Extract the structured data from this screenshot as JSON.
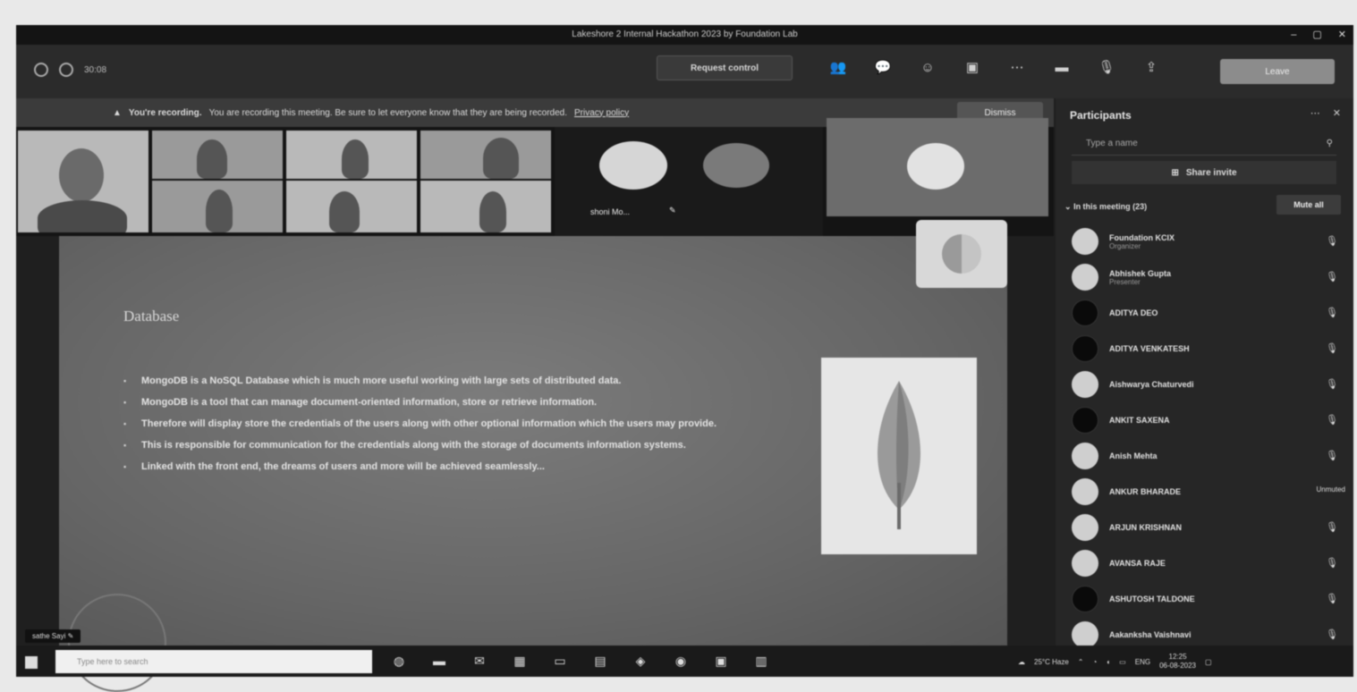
{
  "window": {
    "title": "Lakeshore 2 Internal Hackathon 2023 by Foundation Lab",
    "controls": [
      "–",
      "▢",
      "✕"
    ]
  },
  "toolbar": {
    "meeting_timer": "30:08",
    "request_control": "Request control",
    "icons": [
      "people-icon",
      "chat-icon",
      "reactions-icon",
      "rooms-icon",
      "more-icon",
      "camera-icon",
      "mic-icon",
      "share-icon"
    ],
    "leave_label": "Leave"
  },
  "banner": {
    "strong": "You're recording.",
    "text": "You are recording this meeting. Be sure to let everyone know that they are being recorded.",
    "link": "Privacy policy",
    "dismiss": "Dismiss"
  },
  "video_tiles": {
    "named_tile": "shoni Mo..."
  },
  "slide": {
    "title": "Database",
    "bullets": [
      "MongoDB is a NoSQL Database which is much more useful working with large sets of distributed data.",
      "MongoDB is a tool that can manage document-oriented information, store or retrieve information.",
      "Therefore will display store the credentials of the users along with other optional information which the users may provide.",
      "This is responsible for communication for the credentials along with the storage of documents information systems.",
      "Linked with the front end, the dreams of users and more will be achieved seamlessly..."
    ]
  },
  "presenter_label": "sathe Sayi",
  "participants": {
    "header": "Participants",
    "search_placeholder": "Type a name",
    "share_invite": "Share invite",
    "in_meeting": "In this meeting (23)",
    "mute_all": "Mute all",
    "list": [
      {
        "name": "Foundation KCIX",
        "role": "Organizer",
        "dark": false,
        "status": ""
      },
      {
        "name": "Abhishek Gupta",
        "role": "Presenter",
        "dark": false,
        "status": ""
      },
      {
        "name": "ADITYA DEO",
        "role": "",
        "dark": true,
        "status": ""
      },
      {
        "name": "ADITYA VENKATESH",
        "role": "",
        "dark": true,
        "status": ""
      },
      {
        "name": "Aishwarya Chaturvedi",
        "role": "",
        "dark": false,
        "status": ""
      },
      {
        "name": "ANKIT SAXENA",
        "role": "",
        "dark": true,
        "status": ""
      },
      {
        "name": "Anish Mehta",
        "role": "",
        "dark": false,
        "status": ""
      },
      {
        "name": "ANKUR BHARADE",
        "role": "",
        "dark": false,
        "status": "Unmuted"
      },
      {
        "name": "ARJUN KRISHNAN",
        "role": "",
        "dark": false,
        "status": ""
      },
      {
        "name": "AVANSA RAJE",
        "role": "",
        "dark": false,
        "status": ""
      },
      {
        "name": "ASHUTOSH TALDONE",
        "role": "",
        "dark": true,
        "status": ""
      },
      {
        "name": "Aakanksha Vaishnavi",
        "role": "",
        "dark": false,
        "status": ""
      }
    ]
  },
  "taskbar": {
    "search_placeholder": "Type here to search",
    "weather": "25°C Haze",
    "time": "12:25",
    "date": "06-08-2023"
  }
}
